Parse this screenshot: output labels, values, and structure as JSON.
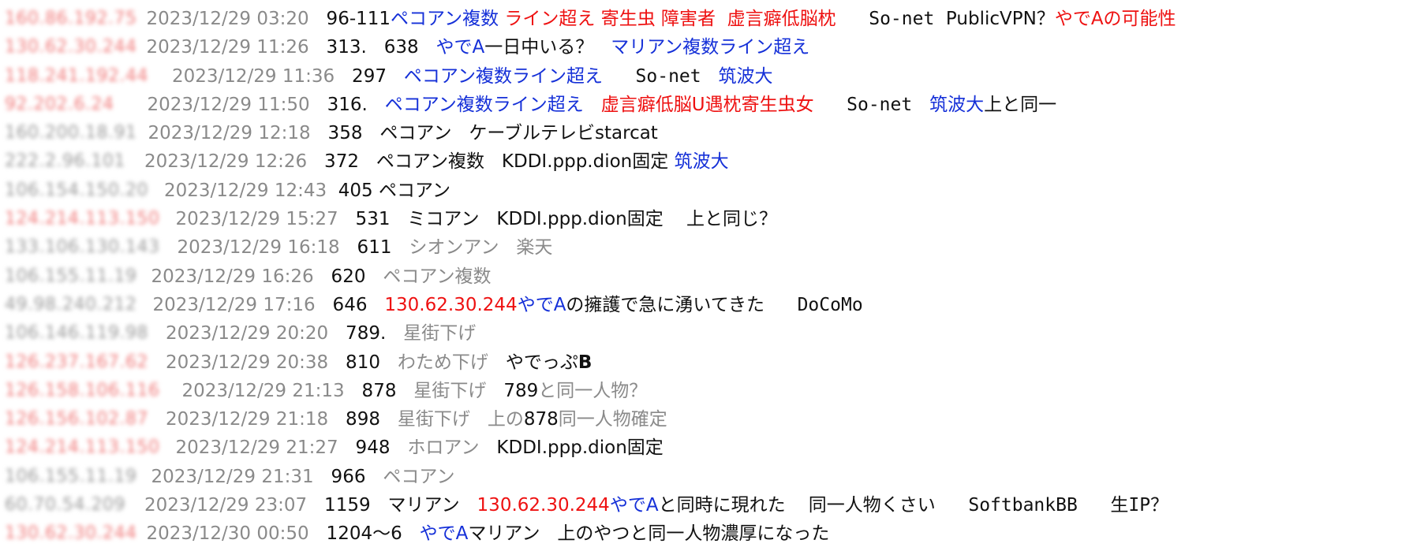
{
  "rows": [
    {
      "ip": "160.86.192.75",
      "ip_color": "red",
      "gap": 12,
      "segments": [
        {
          "text": "2023/12/29 03:20",
          "color": "gray"
        },
        {
          "text": "   96-111",
          "color": "black"
        },
        {
          "text": "ペコアン複数",
          "color": "blue"
        },
        {
          "text": " ライン超え 寄生虫 障害者  虚言癖低脳枕",
          "color": "red"
        },
        {
          "text": "   So-net",
          "color": "black",
          "mono": true
        },
        {
          "text": "  PublicVPN？",
          "color": "black"
        },
        {
          "text": "やでAの可能性",
          "color": "red"
        }
      ]
    },
    {
      "ip": "130.62.30.244",
      "ip_color": "red",
      "gap": 12,
      "segments": [
        {
          "text": "2023/12/29 11:26",
          "color": "gray"
        },
        {
          "text": "   313.   638   ",
          "color": "black"
        },
        {
          "text": "やでA",
          "color": "blue"
        },
        {
          "text": "一日中いる？   ",
          "color": "black"
        },
        {
          "text": "マリアン複数ライン超え",
          "color": "blue"
        }
      ]
    },
    {
      "ip": "118.241.192.44",
      "ip_color": "red",
      "gap": 30,
      "segments": [
        {
          "text": "2023/12/29 11:36",
          "color": "gray"
        },
        {
          "text": "   297   ",
          "color": "black"
        },
        {
          "text": "ペコアン複数ライン超え",
          "color": "blue"
        },
        {
          "text": "   So-net",
          "color": "black",
          "mono": true
        },
        {
          "text": "   筑波大",
          "color": "blue"
        }
      ]
    },
    {
      "ip": "92.202.6.24",
      "ip_color": "red",
      "gap": 42,
      "segments": [
        {
          "text": "2023/12/29 11:50",
          "color": "gray"
        },
        {
          "text": "   316.   ",
          "color": "black"
        },
        {
          "text": "ペコアン複数ライン超え",
          "color": "blue"
        },
        {
          "text": "   虚言癖低脳U遇枕寄生虫女",
          "color": "red"
        },
        {
          "text": "   So-net",
          "color": "black",
          "mono": true
        },
        {
          "text": "   筑波大",
          "color": "blue"
        },
        {
          "text": "上と同一",
          "color": "black"
        }
      ]
    },
    {
      "ip": "160.200.18.91",
      "ip_color": "gray",
      "gap": 14,
      "segments": [
        {
          "text": "2023/12/29 12:18",
          "color": "gray"
        },
        {
          "text": "   358   ペコアン   ケーブルテレビstarcat",
          "color": "black"
        }
      ]
    },
    {
      "ip": "222.2.96.101",
      "ip_color": "gray",
      "gap": 24,
      "segments": [
        {
          "text": "2023/12/29 12:26",
          "color": "gray"
        },
        {
          "text": "   372   ペコアン複数   KDDI.ppp.dion固定 ",
          "color": "black"
        },
        {
          "text": "筑波大",
          "color": "blue"
        }
      ]
    },
    {
      "ip": "106.154.150.20",
      "ip_color": "gray",
      "gap": 20,
      "segments": [
        {
          "text": "2023/12/29 12:43",
          "color": "gray"
        },
        {
          "text": "  405 ペコアン",
          "color": "black"
        }
      ]
    },
    {
      "ip": "124.214.113.150",
      "ip_color": "red",
      "gap": 20,
      "segments": [
        {
          "text": "2023/12/29 15:27",
          "color": "gray"
        },
        {
          "text": "   531   ミコアン   KDDI.ppp.dion固定    上と同じ？",
          "color": "black"
        }
      ]
    },
    {
      "ip": "133.106.130.143",
      "ip_color": "gray",
      "gap": 22,
      "segments": [
        {
          "text": "2023/12/29 16:18",
          "color": "gray"
        },
        {
          "text": "   611   ",
          "color": "black"
        },
        {
          "text": "シオンアン   楽天",
          "color": "dim"
        }
      ]
    },
    {
      "ip": "106.155.11.19",
      "ip_color": "gray",
      "gap": 18,
      "segments": [
        {
          "text": "2023/12/29 16:26",
          "color": "gray"
        },
        {
          "text": "   620   ",
          "color": "black"
        },
        {
          "text": "ペコアン複数",
          "color": "dim"
        }
      ]
    },
    {
      "ip": "49.98.240.212",
      "ip_color": "gray",
      "gap": 20,
      "segments": [
        {
          "text": "2023/12/29 17:16",
          "color": "gray"
        },
        {
          "text": "   646   ",
          "color": "black"
        },
        {
          "text": "130.62.30.244",
          "color": "red"
        },
        {
          "text": "やでA",
          "color": "blue"
        },
        {
          "text": "の擁護で急に湧いてきた",
          "color": "black"
        },
        {
          "text": "   DoCoMo",
          "color": "black",
          "mono": true
        }
      ]
    },
    {
      "ip": "106.146.119.98",
      "ip_color": "gray",
      "gap": 22,
      "segments": [
        {
          "text": "2023/12/29 20:20",
          "color": "gray"
        },
        {
          "text": "   789.   ",
          "color": "black"
        },
        {
          "text": "星街下げ",
          "color": "dim"
        }
      ]
    },
    {
      "ip": "126.237.167.62",
      "ip_color": "red",
      "gap": 22,
      "segments": [
        {
          "text": "2023/12/29 20:38",
          "color": "gray"
        },
        {
          "text": "   810   ",
          "color": "black"
        },
        {
          "text": "わため下げ",
          "color": "dim"
        },
        {
          "text": "   やでっぷ",
          "color": "black"
        },
        {
          "text": "B",
          "color": "black",
          "bold": true
        }
      ]
    },
    {
      "ip": "126.158.106.116",
      "ip_color": "red",
      "gap": 28,
      "segments": [
        {
          "text": "2023/12/29 21:13",
          "color": "gray"
        },
        {
          "text": "   878   ",
          "color": "black"
        },
        {
          "text": "星街下げ",
          "color": "dim"
        },
        {
          "text": "   789",
          "color": "black"
        },
        {
          "text": "と同一人物？",
          "color": "dim"
        }
      ]
    },
    {
      "ip": "126.156.102.87",
      "ip_color": "red",
      "gap": 22,
      "segments": [
        {
          "text": "2023/12/29 21:18",
          "color": "gray"
        },
        {
          "text": "   898   ",
          "color": "black"
        },
        {
          "text": "星街下げ   上の",
          "color": "dim"
        },
        {
          "text": "878",
          "color": "black"
        },
        {
          "text": "同一人物確定",
          "color": "dim"
        }
      ]
    },
    {
      "ip": "124.214.113.150",
      "ip_color": "red",
      "gap": 20,
      "segments": [
        {
          "text": "2023/12/29 21:27",
          "color": "gray"
        },
        {
          "text": "   948   ",
          "color": "black"
        },
        {
          "text": "ホロアン",
          "color": "dim"
        },
        {
          "text": "   KDDI.ppp.dion固定",
          "color": "black"
        }
      ]
    },
    {
      "ip": "106.155.11.19",
      "ip_color": "gray",
      "gap": 18,
      "segments": [
        {
          "text": "2023/12/29 21:31",
          "color": "gray"
        },
        {
          "text": "   966   ",
          "color": "black"
        },
        {
          "text": "ペコアン",
          "color": "dim"
        }
      ]
    },
    {
      "ip": "60.70.54.209",
      "ip_color": "gray",
      "gap": 24,
      "segments": [
        {
          "text": "2023/12/29 23:07",
          "color": "gray"
        },
        {
          "text": "   1159   マリアン   ",
          "color": "black"
        },
        {
          "text": "130.62.30.244",
          "color": "red"
        },
        {
          "text": "やでA",
          "color": "blue"
        },
        {
          "text": "と同時に現れた    同一人物くさい",
          "color": "black"
        },
        {
          "text": "   SoftbankBB   生IP？",
          "color": "black",
          "mono": true
        }
      ]
    },
    {
      "ip": "130.62.30.244",
      "ip_color": "red",
      "gap": 12,
      "segments": [
        {
          "text": "2023/12/30 00:50",
          "color": "gray"
        },
        {
          "text": "   1204〜6   ",
          "color": "black"
        },
        {
          "text": "やでA",
          "color": "blue"
        },
        {
          "text": "マリアン   上のやつと同一人物濃厚になった",
          "color": "black"
        }
      ]
    }
  ]
}
